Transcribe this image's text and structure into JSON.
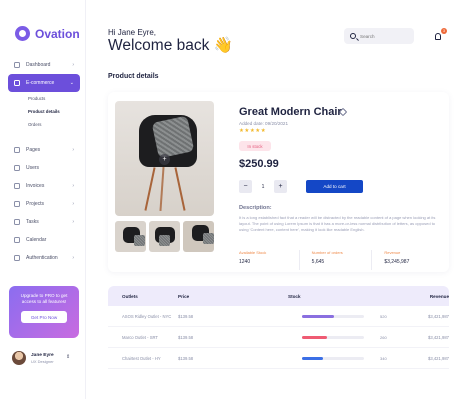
{
  "brand": {
    "name": "Ovation"
  },
  "sidebar": {
    "items": [
      {
        "label": "Dashboard",
        "icon": "dashboard-icon",
        "active": false,
        "chevron": true
      },
      {
        "label": "E-commerce",
        "icon": "cart-icon",
        "active": true,
        "chevron": true
      },
      {
        "label": "Pages",
        "icon": "pages-icon",
        "active": false,
        "chevron": true
      },
      {
        "label": "Users",
        "icon": "users-icon",
        "active": false,
        "chevron": false
      },
      {
        "label": "Invoices",
        "icon": "invoice-icon",
        "active": false,
        "chevron": true
      },
      {
        "label": "Projects",
        "icon": "projects-icon",
        "active": false,
        "chevron": true
      },
      {
        "label": "Tasks",
        "icon": "tasks-icon",
        "active": false,
        "chevron": true
      },
      {
        "label": "Calendar",
        "icon": "calendar-icon",
        "active": false,
        "chevron": false
      },
      {
        "label": "Authentication",
        "icon": "lock-icon",
        "active": false,
        "chevron": true
      }
    ],
    "subitems": [
      "Products",
      "Product details",
      "Orders"
    ],
    "subitem_selected": 1,
    "upgrade": {
      "text": "Upgrade to PRO to get access to all features!",
      "button": "Get Pro Now"
    },
    "user": {
      "name": "Jane Eyre",
      "role": "UX Designer"
    }
  },
  "header": {
    "greeting": "Hi Jane Eyre,",
    "welcome": "Welcome back 👋",
    "search_placeholder": "Search",
    "notifications": "3"
  },
  "page_title": "Product details",
  "product": {
    "name": "Great Modern Chair",
    "added": "Added date: 09/20/2021",
    "stars": "★★★★★",
    "stock_status": "In stock",
    "price": "$250.99",
    "quantity": "1",
    "add_to_cart": "Add to cart",
    "description_title": "Description:",
    "description": "It is a long established fact that a reader will be distracted by the readable content of a page when looking at its layout. The point of using Lorem Ipsum is that it has a more-or-less normal distribution of letters, as opposed to using 'Content here, content here', making it look like readable English.",
    "stats": [
      {
        "label": "Available Stock",
        "value": "1240"
      },
      {
        "label": "Number of orders",
        "value": "5,645"
      },
      {
        "label": "Revenue",
        "value": "$3,245,987"
      }
    ]
  },
  "outlets": {
    "headers": [
      "Outlets",
      "Price",
      "Stock",
      "Revenue"
    ],
    "rows": [
      {
        "name": "ASOS Ridley Outlet - NYC",
        "price": "$139.58",
        "stock": 520,
        "stock_fraction": 0.52,
        "bar_color": "#8a6fe0",
        "revenue": "$3,421,987"
      },
      {
        "name": "Marco Outlet - SRT",
        "price": "$139.58",
        "stock": 260,
        "stock_fraction": 0.4,
        "bar_color": "#ef5b73",
        "revenue": "$3,421,987"
      },
      {
        "name": "Chairtest Outlet - HY",
        "price": "$139.58",
        "stock": 340,
        "stock_fraction": 0.34,
        "bar_color": "#3b6fe6",
        "revenue": "$3,421,987"
      }
    ]
  }
}
